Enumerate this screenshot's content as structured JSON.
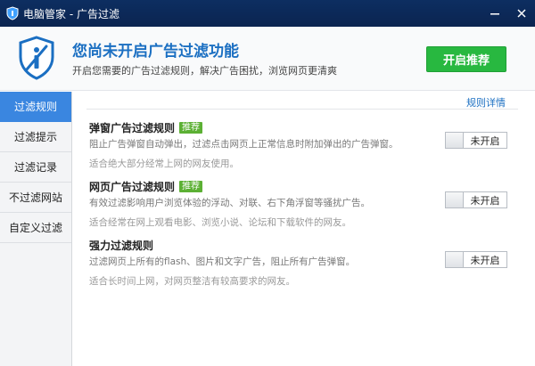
{
  "window": {
    "title": "电脑管家 - 广告过滤",
    "icons": {
      "logo": "qq-pc-manager-logo",
      "minimize": "minimize-icon",
      "close": "close-icon"
    }
  },
  "banner": {
    "icon": "shield-icon",
    "title": "您尚未开启广告过滤功能",
    "subtitle": "开启您需要的广告过滤规则，解决广告困扰，浏览网页更清爽",
    "enable_button": "开启推荐"
  },
  "sidebar": {
    "items": [
      {
        "label": "过滤规则",
        "active": true
      },
      {
        "label": "过滤提示",
        "active": false
      },
      {
        "label": "过滤记录",
        "active": false
      },
      {
        "label": "不过滤网站",
        "active": false
      },
      {
        "label": "自定义过滤",
        "active": false
      }
    ]
  },
  "main": {
    "details_link": "规则详情",
    "rules": [
      {
        "title": "弹窗广告过滤规则",
        "badge": "推荐",
        "description": "阻止广告弹窗自动弹出，过滤点击网页上正常信息时附加弹出的广告弹窗。",
        "note": "适合绝大部分经常上网的网友使用。",
        "toggle_label": "未开启"
      },
      {
        "title": "网页广告过滤规则",
        "badge": "推荐",
        "description": "有效过滤影响用户浏览体验的浮动、对联、右下角浮窗等骚扰广告。",
        "note": "适合经常在网上观看电影、浏览小说、论坛和下载软件的网友。",
        "toggle_label": "未开启"
      },
      {
        "title": "强力过滤规则",
        "badge": "",
        "description": "过滤网页上所有的flash、图片和文字广告，阻止所有广告弹窗。",
        "note": "适合长时间上网，对网页整洁有较高要求的网友。",
        "toggle_label": "未开启"
      }
    ]
  },
  "colors": {
    "titlebar": "#0d2e61",
    "accent_blue": "#1b6fc2",
    "sidebar_active": "#3a86e0",
    "enable_green": "#28b840",
    "badge_green": "#5cb034"
  }
}
